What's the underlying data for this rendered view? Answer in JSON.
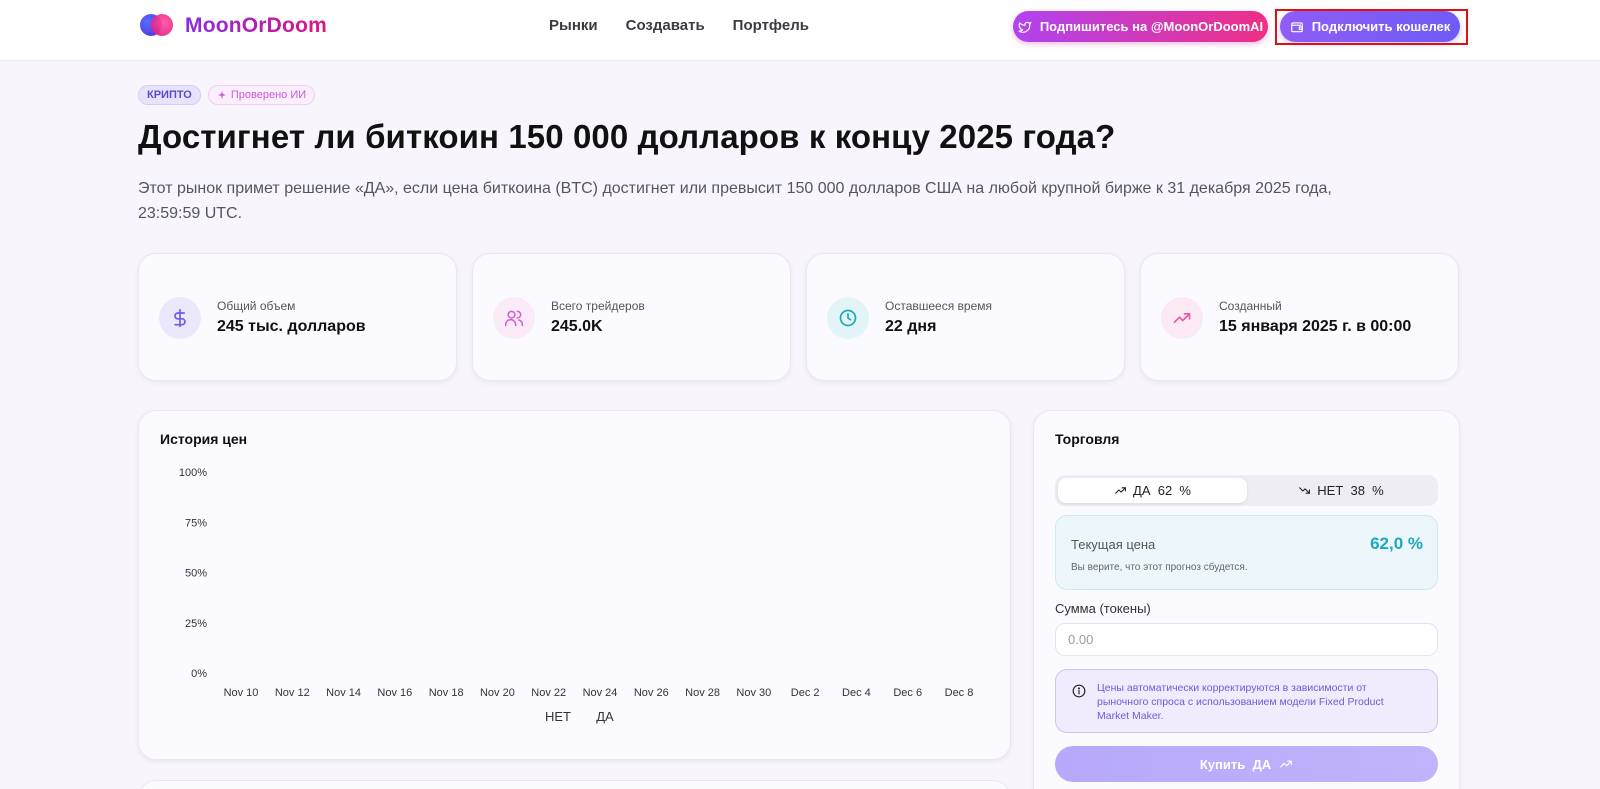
{
  "header": {
    "brand": "MoonOrDoom",
    "nav": [
      "Рынки",
      "Создавать",
      "Портфель"
    ],
    "follow_label": "Подпишитесь на @MoonOrDoomAI",
    "connect_label": "Подключить кошелек"
  },
  "tags": {
    "category": "КРИПТО",
    "verified": "Проверено ИИ"
  },
  "market": {
    "title": "Достигнет ли биткоин 150 000 долларов к концу 2025 года?",
    "description": "Этот рынок примет решение «ДА», если цена биткоина (BTC) достигнет или превысит 150 000 долларов США на любой крупной бирже к 31 декабря 2025 года, 23:59:59 UTC."
  },
  "stats": [
    {
      "label": "Общий объем",
      "value": "245 тыс. долларов",
      "icon": "dollar-icon",
      "color": "#6b5ce7",
      "bg": "#ece8fb"
    },
    {
      "label": "Всего трейдеров",
      "value": "245.0K",
      "icon": "users-icon",
      "color": "#d65ad0",
      "bg": "#fbeaf8"
    },
    {
      "label": "Оставшееся время",
      "value": "22 дня",
      "icon": "clock-icon",
      "color": "#1aa9b8",
      "bg": "#e3f4f6"
    },
    {
      "label": "Созданный",
      "value": "15 января 2025 г. в 00:00",
      "icon": "trend-icon",
      "color": "#e45aa6",
      "bg": "#fbe9f3"
    }
  ],
  "price_history": {
    "title": "История цен",
    "legend": [
      "НЕТ",
      "ДА"
    ]
  },
  "chart_data": {
    "type": "line",
    "title": "История цен",
    "categories": [
      "Nov 10",
      "Nov 12",
      "Nov 14",
      "Nov 16",
      "Nov 18",
      "Nov 20",
      "Nov 22",
      "Nov 24",
      "Nov 26",
      "Nov 28",
      "Nov 30",
      "Dec 2",
      "Dec 4",
      "Dec 6",
      "Dec 8"
    ],
    "y_ticks": [
      "100%",
      "75%",
      "50%",
      "25%",
      "0%"
    ],
    "series": [
      {
        "name": "НЕТ",
        "values": []
      },
      {
        "name": "ДА",
        "values": []
      }
    ],
    "ylim": [
      0,
      100
    ],
    "legend": "bottom"
  },
  "trade": {
    "title": "Торговля",
    "yes_tab": "ДА  62  %",
    "no_tab": "НЕТ  38  %",
    "current_price_label": "Текущая цена",
    "current_price_value": "62,0 %",
    "current_price_note": "Вы верите, что этот прогноз сбудется.",
    "amount_label": "Сумма (токены)",
    "amount_placeholder": "0.00",
    "info_text": "Цены автоматически корректируются в зависимости от рыночного спроса с использованием модели Fixed Product Market Maker.",
    "buy_label": "Купить  ДА"
  }
}
